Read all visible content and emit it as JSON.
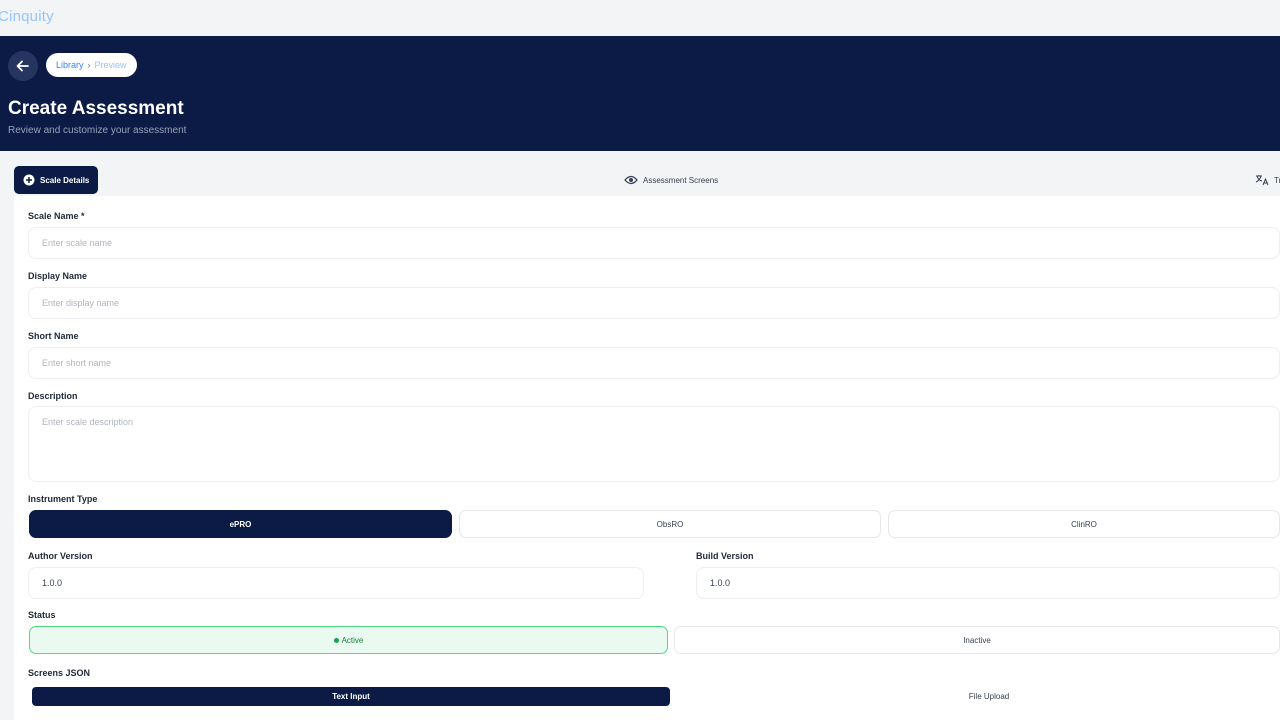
{
  "app": {
    "brand": "Cinquity"
  },
  "header": {
    "breadcrumb": [
      "Library",
      "Preview"
    ],
    "title": "Create Assessment",
    "subtitle": "Review and customize your assessment"
  },
  "tabs": [
    {
      "label": "Scale Details",
      "icon": "plus-circle-icon",
      "active": true
    },
    {
      "label": "Assessment Screens",
      "icon": "eye-icon",
      "active": false
    },
    {
      "label": "Tr",
      "icon": "translate-icon",
      "active": false
    }
  ],
  "form": {
    "scale_name": {
      "label": "Scale Name *",
      "placeholder": "Enter scale name"
    },
    "display_name": {
      "label": "Display Name",
      "placeholder": "Enter display name"
    },
    "short_name": {
      "label": "Short Name",
      "placeholder": "Enter short name"
    },
    "description": {
      "label": "Description",
      "placeholder": "Enter scale description"
    },
    "instrument_type": {
      "label": "Instrument Type",
      "options": [
        "ePRO",
        "ObsRO",
        "ClinRO"
      ],
      "selected": "ePRO"
    },
    "author_version": {
      "label": "Author Version",
      "value": "1.0.0"
    },
    "build_version": {
      "label": "Build Version",
      "value": "1.0.0"
    },
    "status": {
      "label": "Status",
      "options": [
        "Active",
        "Inactive"
      ],
      "selected": "Active"
    },
    "screens_json": {
      "label": "Screens JSON",
      "options": [
        "Text Input",
        "File Upload"
      ],
      "selected": "Text Input"
    }
  },
  "colors": {
    "navy": "#0b1b45",
    "active_green": "#4ade80",
    "brand_blue": "#93c5fd"
  }
}
